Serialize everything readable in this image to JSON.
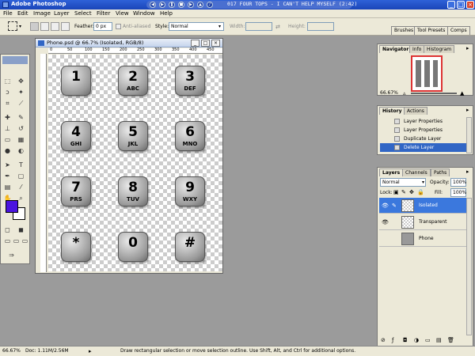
{
  "app": {
    "title": "Adobe Photoshop"
  },
  "media": {
    "song": "017    FOUR TOPS - I CAN'T HELP MYSELF (2:42)"
  },
  "menu": [
    "File",
    "Edit",
    "Image",
    "Layer",
    "Select",
    "Filter",
    "View",
    "Window",
    "Help"
  ],
  "options": {
    "feather_label": "Feather:",
    "feather_value": "0 px",
    "anti_aliased": "Anti-aliased",
    "style_label": "Style:",
    "style_value": "Normal",
    "width_label": "Width:",
    "height_label": "Height:",
    "palette_tabs": [
      "Brushes",
      "Tool Presets",
      "Comps"
    ]
  },
  "document": {
    "title": "Phone.psd @ 66.7% (Isolated, RGB/8)",
    "ruler_marks": [
      "0",
      "50",
      "100",
      "150",
      "200",
      "250",
      "300",
      "350",
      "400",
      "450"
    ],
    "keys": [
      {
        "digit": "1",
        "letters": ""
      },
      {
        "digit": "2",
        "letters": "ABC"
      },
      {
        "digit": "3",
        "letters": "DEF"
      },
      {
        "digit": "4",
        "letters": "GHI"
      },
      {
        "digit": "5",
        "letters": "JKL"
      },
      {
        "digit": "6",
        "letters": "MNO"
      },
      {
        "digit": "7",
        "letters": "PRS"
      },
      {
        "digit": "8",
        "letters": "TUV"
      },
      {
        "digit": "9",
        "letters": "WXY"
      },
      {
        "digit": "*",
        "letters": ""
      },
      {
        "digit": "0",
        "letters": ""
      },
      {
        "digit": "#",
        "letters": ""
      }
    ]
  },
  "navigator": {
    "tabs": [
      "Navigator",
      "Info",
      "Histogram"
    ],
    "zoom": "66.67%"
  },
  "history": {
    "tabs": [
      "History",
      "Actions"
    ],
    "items": [
      "Layer Properties",
      "Layer Properties",
      "Duplicate Layer",
      "Delete Layer"
    ]
  },
  "layers": {
    "tabs": [
      "Layers",
      "Channels",
      "Paths"
    ],
    "blend_mode": "Normal",
    "opacity_label": "Opacity:",
    "opacity_value": "100%",
    "lock_label": "Lock:",
    "fill_label": "Fill:",
    "fill_value": "100%",
    "items": [
      {
        "name": "Isolated",
        "selected": true
      },
      {
        "name": "Transparent",
        "selected": false
      },
      {
        "name": "Phone",
        "selected": false
      }
    ]
  },
  "status": {
    "zoom": "66.67%",
    "doc": "Doc: 1.11M/2.56M",
    "hint": "Draw rectangular selection or move selection outline.  Use Shift, Alt, and Ctrl for additional options."
  },
  "colors": {
    "foreground": "#4a14e0",
    "background": "#ffffff",
    "accent": "#3166c5"
  }
}
